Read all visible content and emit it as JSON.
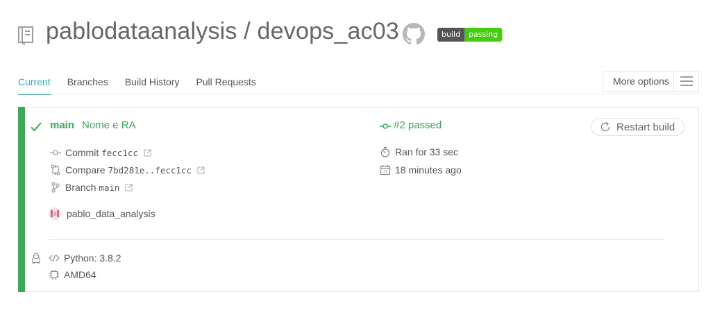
{
  "header": {
    "repo_title": "pablodataanalysis / devops_ac03",
    "badge": {
      "left": "build",
      "right": "passing"
    }
  },
  "tabs": [
    {
      "label": "Current",
      "active": true
    },
    {
      "label": "Branches",
      "active": false
    },
    {
      "label": "Build History",
      "active": false
    },
    {
      "label": "Pull Requests",
      "active": false
    }
  ],
  "more_options": {
    "label": "More options"
  },
  "build": {
    "branch": "main",
    "message": "Nome e RA",
    "status": "#2 passed",
    "restart_label": "Restart build",
    "commit_label": "Commit",
    "commit_hash": "fecc1cc",
    "compare_label": "Compare",
    "compare_range": "7bd281e..fecc1cc",
    "branch_label": "Branch",
    "branch_value": "main",
    "duration": "Ran for 33 sec",
    "finished": "18 minutes ago",
    "author": "pablo_data_analysis"
  },
  "job": {
    "language": "Python: 3.8.2",
    "arch": "AMD64",
    "os_icon": "linux-penguin-icon"
  },
  "colors": {
    "passed": "#39aa56",
    "tab_active": "#3eaaaf",
    "badge_left": "#555555",
    "badge_right": "#44cc11"
  }
}
